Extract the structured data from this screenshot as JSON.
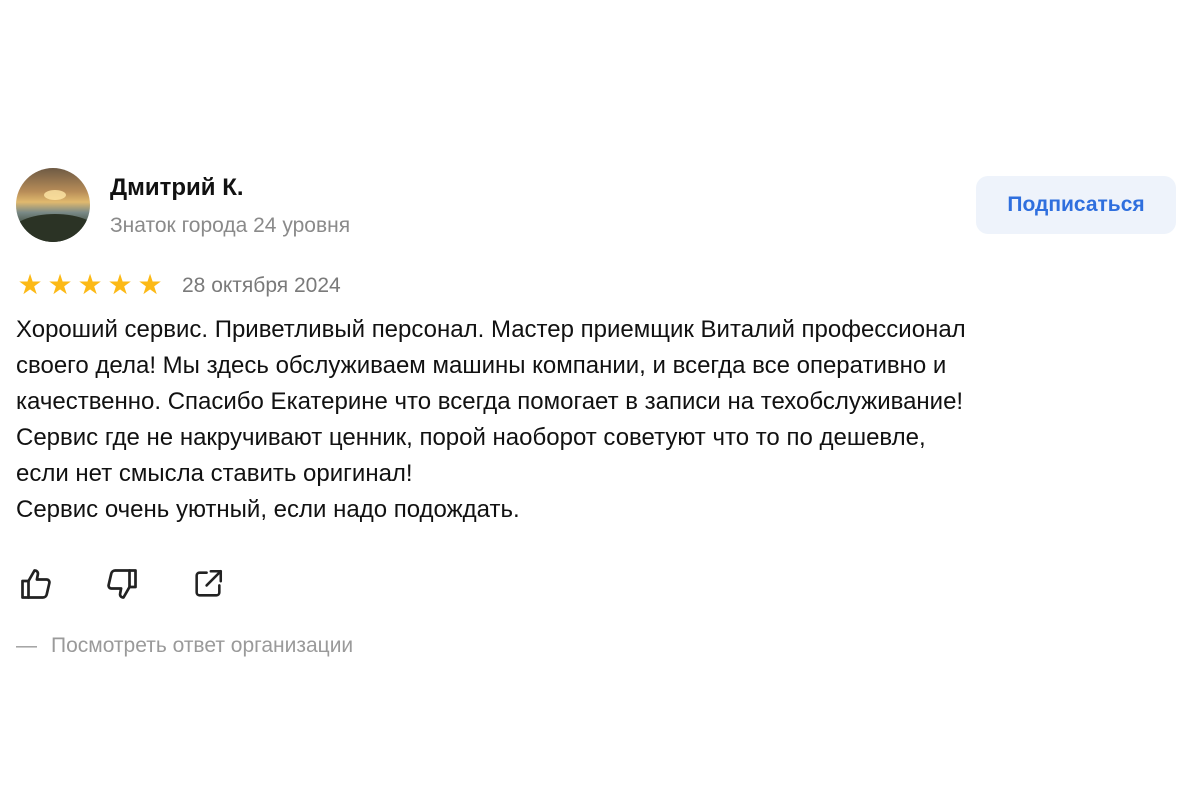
{
  "author": {
    "name": "Дмитрий К.",
    "level": "Знаток города 24 уровня"
  },
  "subscribe_label": "Подписаться",
  "rating": {
    "stars": [
      "★",
      "★",
      "★",
      "★",
      "★"
    ],
    "value": 5,
    "max": 5,
    "color": "#FCB916"
  },
  "date": "28 октября 2024",
  "text_lines": [
    "Хороший сервис. Приветливый персонал. Мастер приемщик Виталий профессионал",
    "своего дела! Мы здесь обслуживаем машины компании, и всегда все оперативно и",
    "качественно. Спасибо Екатерине что всегда помогает в записи на техобслуживание!",
    "Сервис где не накручивают ценник, порой наоборот советуют что то по дешевле,",
    "если нет смысла ставить оригинал!",
    "Сервис очень уютный, если надо подождать."
  ],
  "actions": [
    "thumbs-up-icon",
    "thumbs-down-icon",
    "share-icon"
  ],
  "org_response": {
    "dash": "—",
    "label": "Посмотреть ответ организации"
  }
}
